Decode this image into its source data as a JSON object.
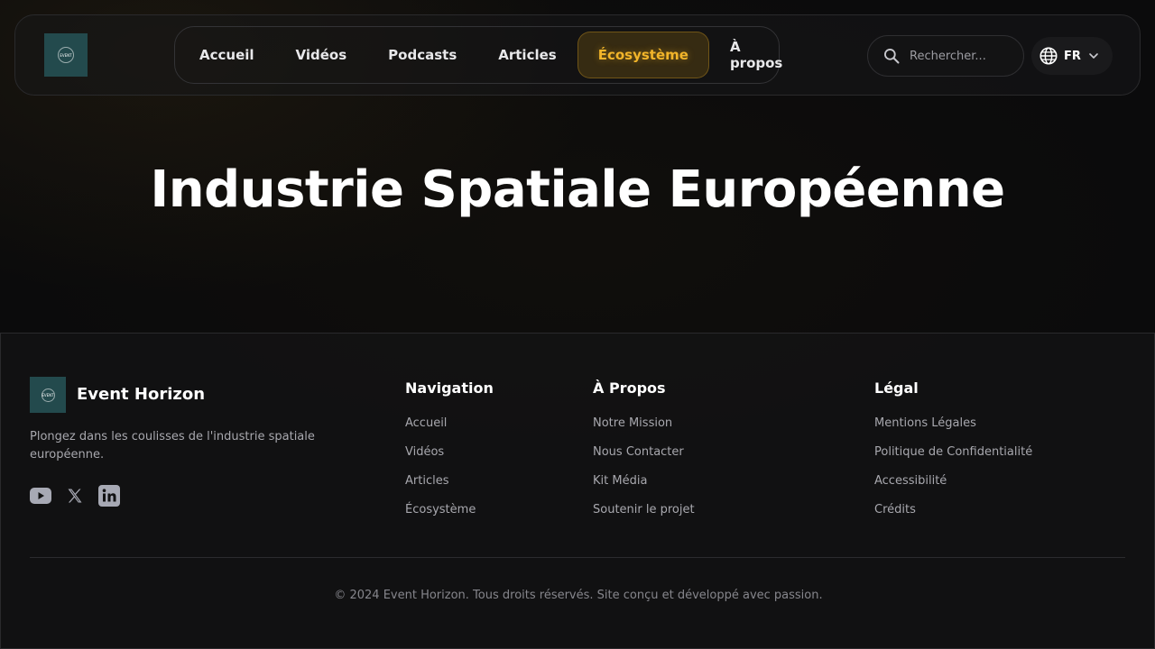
{
  "header": {
    "logo_text": "EVENT",
    "nav": [
      {
        "label": "Accueil"
      },
      {
        "label": "Vidéos"
      },
      {
        "label": "Podcasts"
      },
      {
        "label": "Articles"
      },
      {
        "label": "Écosystème",
        "active": true
      },
      {
        "label": "À propos"
      }
    ],
    "search": {
      "placeholder": "Rechercher..."
    },
    "language": {
      "label": "FR"
    }
  },
  "hero": {
    "title": "Industrie Spatiale Européenne"
  },
  "footer": {
    "brand": {
      "name": "Event Horizon",
      "description": "Plongez dans les coulisses de l'industrie spatiale européenne."
    },
    "socials": [
      "youtube-icon",
      "x-icon",
      "linkedin-icon"
    ],
    "columns": [
      {
        "title": "Navigation",
        "links": [
          "Accueil",
          "Vidéos",
          "Articles",
          "Écosystème"
        ]
      },
      {
        "title": "À Propos",
        "links": [
          "Notre Mission",
          "Nous Contacter",
          "Kit Média",
          "Soutenir le projet"
        ]
      },
      {
        "title": "Légal",
        "links": [
          "Mentions Légales",
          "Politique de Confidentialité",
          "Accessibilité",
          "Crédits"
        ]
      }
    ],
    "copyright": "© 2024 Event Horizon. Tous droits réservés. Site conçu et développé avec passion."
  },
  "colors": {
    "accent": "#f2b52a",
    "logo_bg": "#234a4d",
    "background": "#0b0b0c"
  }
}
